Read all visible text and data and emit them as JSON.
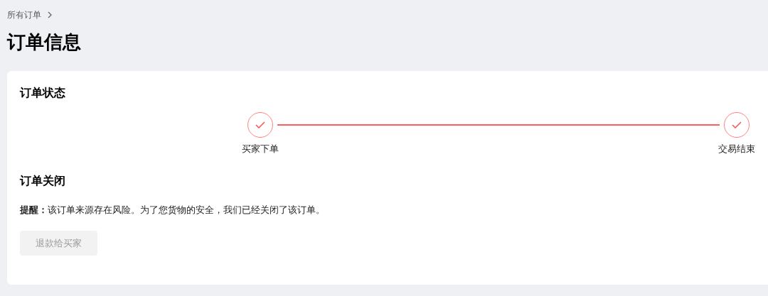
{
  "breadcrumb": {
    "label": "所有订单"
  },
  "title": "订单信息",
  "status_card": {
    "heading": "订单状态",
    "steps": [
      {
        "label": "买家下单",
        "done": true
      },
      {
        "label": "交易结束",
        "done": true
      }
    ],
    "closed_heading": "订单关闭",
    "notice": "**提醒：**该订单来源存在风险。为了您货物的安全，我们已经关闭了该订单。",
    "button": {
      "label": "退款给买家",
      "disabled": true
    }
  }
}
